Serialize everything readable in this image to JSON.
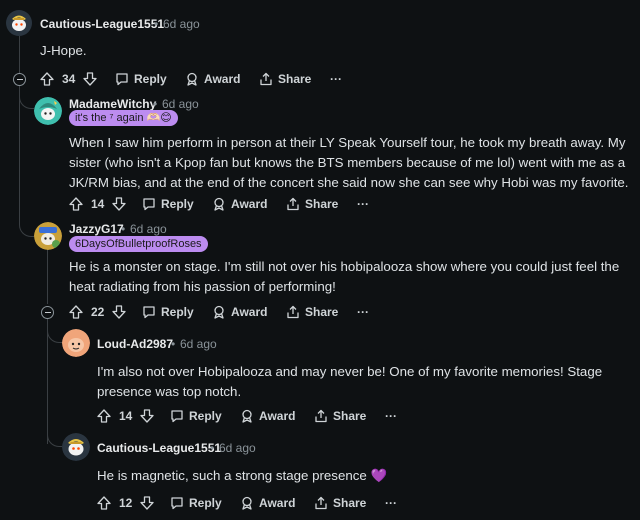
{
  "comments": [
    {
      "username": "Cautious-League1551",
      "time": "6d ago",
      "body": "J-Hope.",
      "votes": "34",
      "reply_label": "Reply",
      "award_label": "Award",
      "share_label": "Share",
      "more_label": "···"
    },
    {
      "username": "MadameWitchy",
      "time": "6d ago",
      "flair": "it's the ⁷ again 🫶🏻😊",
      "body": "When I saw him perform in person at their LY Speak Yourself tour, he took my breath away. My sister (who isn't a Kpop fan but knows the BTS members because of me lol) went with me as a JK/RM bias, and at the end of the concert she said now she can see why Hobi was my favorite.",
      "votes": "14",
      "reply_label": "Reply",
      "award_label": "Award",
      "share_label": "Share",
      "more_label": "···"
    },
    {
      "username": "JazzyG17",
      "time": "6d ago",
      "flair": "6DaysOfBulletproofRoses",
      "body": "He is a monster on stage. I'm still not over his hobipalooza show where you could just feel the heat radiating from his passion of performing!",
      "votes": "22",
      "reply_label": "Reply",
      "award_label": "Award",
      "share_label": "Share",
      "more_label": "···"
    },
    {
      "username": "Loud-Ad2987",
      "time": "6d ago",
      "body": "I'm also not over Hobipalooza and may never be! One of my favorite memories! Stage presence was top notch.",
      "votes": "14",
      "reply_label": "Reply",
      "award_label": "Award",
      "share_label": "Share",
      "more_label": "···"
    },
    {
      "username": "Cautious-League1551",
      "time": "6d ago",
      "body": "He is magnetic, such a strong stage presence 💜",
      "votes": "12",
      "reply_label": "Reply",
      "award_label": "Award",
      "share_label": "Share",
      "more_label": "···"
    }
  ],
  "separator": "•",
  "colors": {
    "background": "#0e1113",
    "flair": "#bc8cf0",
    "thread_line": "#3a3f43",
    "meta": "#8a9399"
  }
}
